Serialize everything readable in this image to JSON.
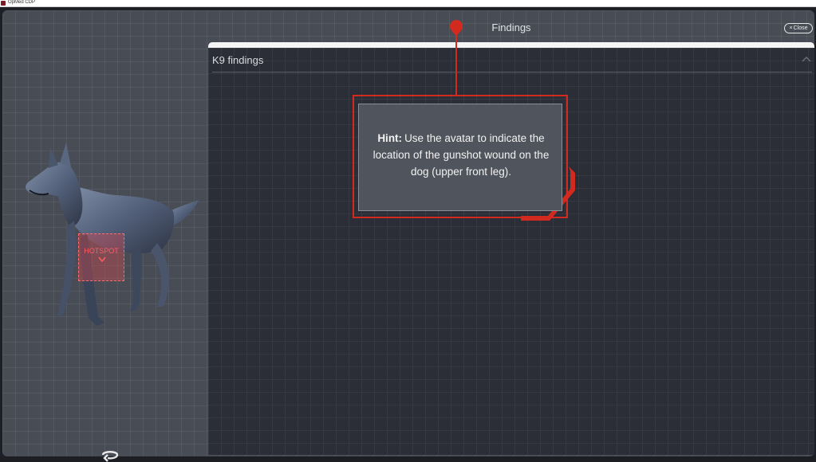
{
  "window": {
    "title": "OpMed CDP"
  },
  "header": {
    "title": "Findings",
    "close_label": "Close"
  },
  "panel": {
    "title": "K9 findings"
  },
  "hint": {
    "label": "Hint:",
    "text": "Use the avatar to indicate the location of the gunshot wound on the dog (upper front leg)."
  },
  "avatar": {
    "hotspot_label": "HOTSPOT"
  },
  "icons": {
    "app": "app-icon",
    "close": "close-icon",
    "collapse": "chevron-up-icon",
    "rotate": "rotate-icon",
    "hotspot_arrow": "chevron-down-icon"
  },
  "colors": {
    "accent": "#d22a1e",
    "hotspot": "#ff5c62",
    "panel": "#2b2e37",
    "frame": "#484c55"
  }
}
